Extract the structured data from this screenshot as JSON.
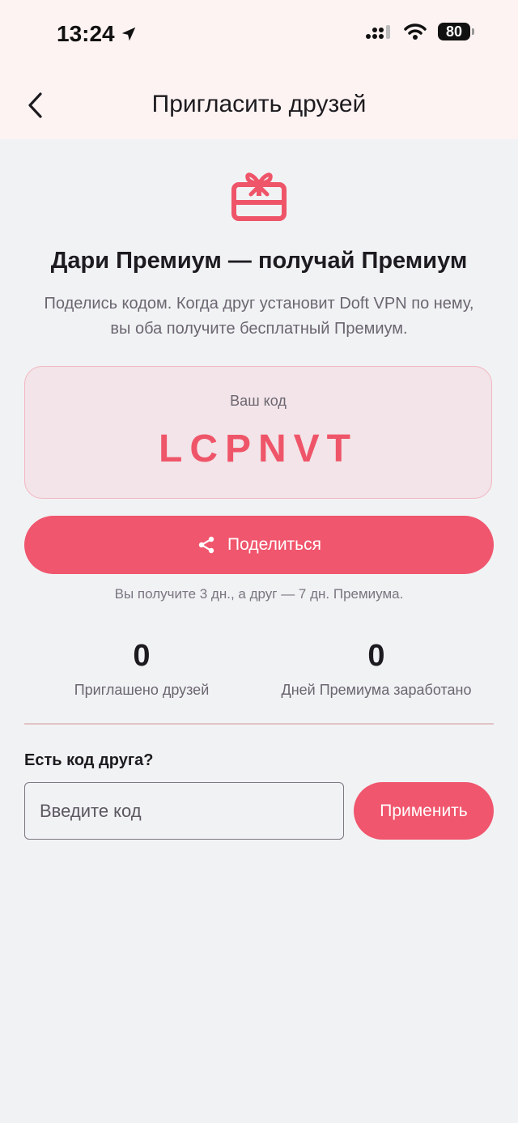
{
  "status_bar": {
    "time": "13:24",
    "battery": "80"
  },
  "header": {
    "title": "Пригласить друзей"
  },
  "hero": {
    "icon": "gift-icon",
    "title": "Дари Премиум — получай Премиум",
    "description": "Поделись кодом. Когда друг установит Doft VPN по нему, вы оба получите бесплатный Премиум."
  },
  "code_card": {
    "label": "Ваш код",
    "code": "LCPNVT"
  },
  "share": {
    "label": "Поделиться",
    "note": "Вы получите 3 дн., а друг — 7 дн. Премиума."
  },
  "stats": [
    {
      "value": "0",
      "label": "Приглашено друзей"
    },
    {
      "value": "0",
      "label": "Дней Премиума заработано"
    }
  ],
  "redeem": {
    "label": "Есть код друга?",
    "placeholder": "Введите код",
    "button": "Применить"
  },
  "colors": {
    "accent": "#f0566d",
    "code_card_bg": "#f2e4e8",
    "header_bg": "#fdf3f2",
    "page_bg": "#f1f2f4"
  }
}
